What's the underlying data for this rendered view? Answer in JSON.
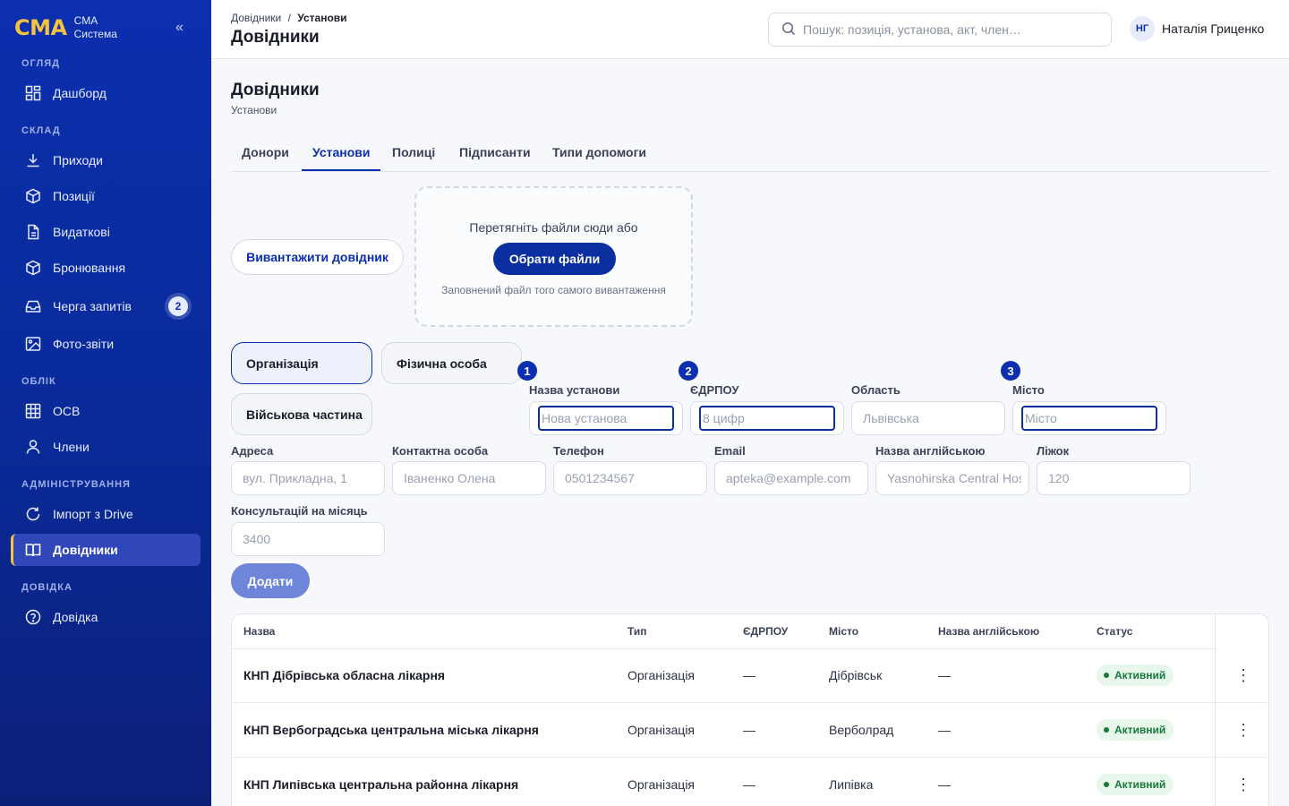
{
  "brand": {
    "logo": "CMA",
    "line1": "CMA",
    "line2": "Система",
    "collapse": "«"
  },
  "sidebar": {
    "sections": [
      {
        "label": "ОГЛЯД"
      },
      {
        "label": "СКЛАД"
      },
      {
        "label": "ОБЛІК"
      },
      {
        "label": "АДМІНІСТРУВАННЯ"
      },
      {
        "label": "ДОВІДКА"
      }
    ],
    "items": [
      {
        "label": "Дашборд",
        "icon": "dashboard-icon"
      },
      {
        "label": "Приходи",
        "icon": "download-icon"
      },
      {
        "label": "Позиції",
        "icon": "box-icon"
      },
      {
        "label": "Видаткові",
        "icon": "document-icon"
      },
      {
        "label": "Бронювання",
        "icon": "box-icon"
      },
      {
        "label": "Черга запитів",
        "icon": "inbox-icon",
        "badge": "2"
      },
      {
        "label": "Фото-звіти",
        "icon": "image-icon"
      },
      {
        "label": "ОСВ",
        "icon": "table-icon"
      },
      {
        "label": "Члени",
        "icon": "user-icon"
      },
      {
        "label": "Імпорт з Drive",
        "icon": "refresh-icon"
      },
      {
        "label": "Довідники",
        "icon": "book-icon",
        "active": true
      },
      {
        "label": "Довідка",
        "icon": "help-icon"
      }
    ]
  },
  "header": {
    "breadcrumb_root": "Довідники",
    "breadcrumb_sep": "/",
    "breadcrumb_current": "Установи",
    "title": "Довідники",
    "search_placeholder": "Пошук: позиція, установа, акт, член…",
    "user_initials": "НГ",
    "user_name": "Наталія Гриценко"
  },
  "page": {
    "title": "Довідники",
    "subtitle": "Установи",
    "tabs": [
      "Донори",
      "Установи",
      "Полиці",
      "Підписанти",
      "Типи допомоги"
    ],
    "active_tab": "Установи"
  },
  "upload": {
    "download_button": "Вивантажити довідник",
    "drop_text": "Перетягніть файли сюди або",
    "choose_button": "Обрати файли",
    "hint": "Заповнений файл того самого вивантаження"
  },
  "form": {
    "types": [
      "Організація",
      "Фізична особа",
      "Військова частина"
    ],
    "active_type": "Організація",
    "steps": [
      "1",
      "2",
      "3"
    ],
    "fields": {
      "name": {
        "label": "Назва установи",
        "placeholder": "Нова установа"
      },
      "edrpou": {
        "label": "ЄДРПОУ",
        "placeholder": "8 цифр"
      },
      "region": {
        "label": "Область",
        "placeholder": "Львівська"
      },
      "city": {
        "label": "Місто",
        "placeholder": "Місто"
      },
      "address": {
        "label": "Адреса",
        "placeholder": "вул. Прикладна, 1"
      },
      "contact": {
        "label": "Контактна особа",
        "placeholder": "Іваненко Олена"
      },
      "phone": {
        "label": "Телефон",
        "placeholder": "0501234567"
      },
      "email": {
        "label": "Email",
        "placeholder": "apteka@example.com"
      },
      "name_en": {
        "label": "Назва англійською",
        "placeholder": "Yasnohirska Central Hosp"
      },
      "beds": {
        "label": "Ліжок",
        "placeholder": "120"
      },
      "consultations": {
        "label": "Консультацій на місяць",
        "placeholder": "3400"
      }
    },
    "add_button": "Додати"
  },
  "table": {
    "columns": [
      "Назва",
      "Тип",
      "ЄДРПОУ",
      "Місто",
      "Назва англійською",
      "Статус"
    ],
    "rows": [
      {
        "name": "КНП Дібрівська обласна лікарня",
        "type": "Організація",
        "edrpou": "—",
        "city": "Дібрівськ",
        "name_en": "—",
        "status": "Активний"
      },
      {
        "name": "КНП Вербоградська центральна міська лікарня",
        "type": "Організація",
        "edrpou": "—",
        "city": "Верболрад",
        "name_en": "—",
        "status": "Активний"
      },
      {
        "name": "КНП Липівська центральна районна лікарня",
        "type": "Організація",
        "edrpou": "—",
        "city": "Липівка",
        "name_en": "—",
        "status": "Активний"
      }
    ],
    "row_menu": "⋮"
  },
  "colors": {
    "primary": "#0b2fae",
    "accent": "#f5c242",
    "success": "#177a3a"
  }
}
